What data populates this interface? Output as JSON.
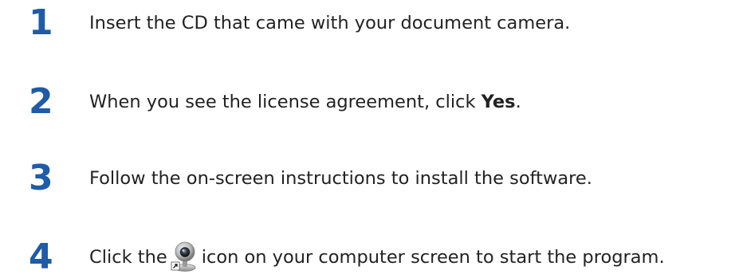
{
  "colors": {
    "step_number": "#1f5ba6",
    "body_text": "#222222"
  },
  "steps": [
    {
      "number": "1",
      "text": "Insert the CD that came with your document camera."
    },
    {
      "number": "2",
      "text_before": "When you see the license agreement, click ",
      "bold": "Yes",
      "text_after": "."
    },
    {
      "number": "3",
      "text": "Follow the on-screen instructions to install the software."
    },
    {
      "number": "4",
      "text_before": "Click the",
      "icon": "webcam-shortcut-icon",
      "text_after": "icon on your computer screen to start the program."
    }
  ]
}
